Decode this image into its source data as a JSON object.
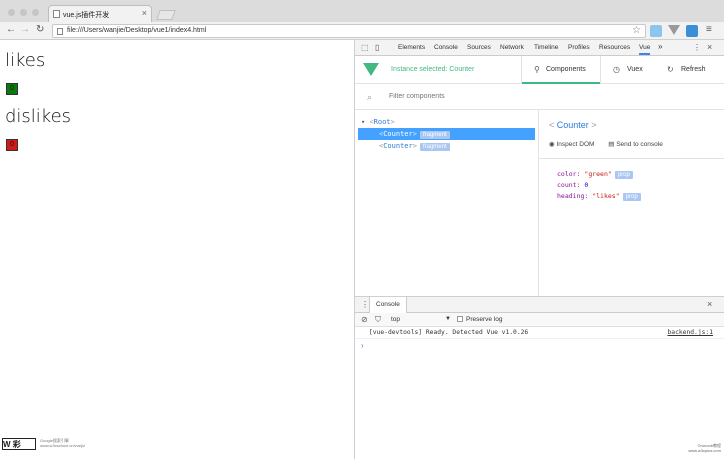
{
  "browser": {
    "tab_title": "vue.js插件开发",
    "url": "file:///Users/wanjie/Desktop/vue1/index4.html"
  },
  "page": {
    "likes": {
      "heading": "likes",
      "count": "0",
      "color": "#0a7a0a"
    },
    "dislikes": {
      "heading": "dislikes",
      "count": "0",
      "color": "#d11a1a"
    }
  },
  "devtools": {
    "tabs": [
      "Elements",
      "Console",
      "Sources",
      "Network",
      "Timeline",
      "Profiles",
      "Resources",
      "Vue"
    ],
    "active_tab": "Vue",
    "more": "»"
  },
  "vue": {
    "instance_selected": "Instance selected: Counter",
    "tabs": {
      "components": "Components",
      "vuex": "Vuex",
      "refresh": "Refresh"
    },
    "filter_placeholder": "Filter components",
    "tree": {
      "root": "Root",
      "items": [
        {
          "name": "Counter",
          "tag": "fragment",
          "selected": true
        },
        {
          "name": "Counter",
          "tag": "fragment",
          "selected": false
        }
      ]
    },
    "inspector": {
      "title": "Counter",
      "inspect_dom": "Inspect DOM",
      "send_to_console": "Send to console",
      "props": [
        {
          "key": "color",
          "value": "\"green\"",
          "kind": "string",
          "tag": "prop"
        },
        {
          "key": "count",
          "value": "0",
          "kind": "number",
          "tag": ""
        },
        {
          "key": "heading",
          "value": "\"likes\"",
          "kind": "string",
          "tag": "prop"
        }
      ]
    }
  },
  "console": {
    "tab": "Console",
    "context": "top",
    "preserve_log": "Preserve log",
    "log": "[vue-devtools] Ready. Detected Vue v1.0.26",
    "source": "backend.js:1"
  },
  "watermark": {
    "logo": "W 彩",
    "lines": [
      "Google搜索引擎",
      "www.w3cschool.cn/vuejs/"
    ]
  },
  "corner": {
    "lines": [
      "©runoob教程",
      "www.w3cplus.com"
    ]
  }
}
